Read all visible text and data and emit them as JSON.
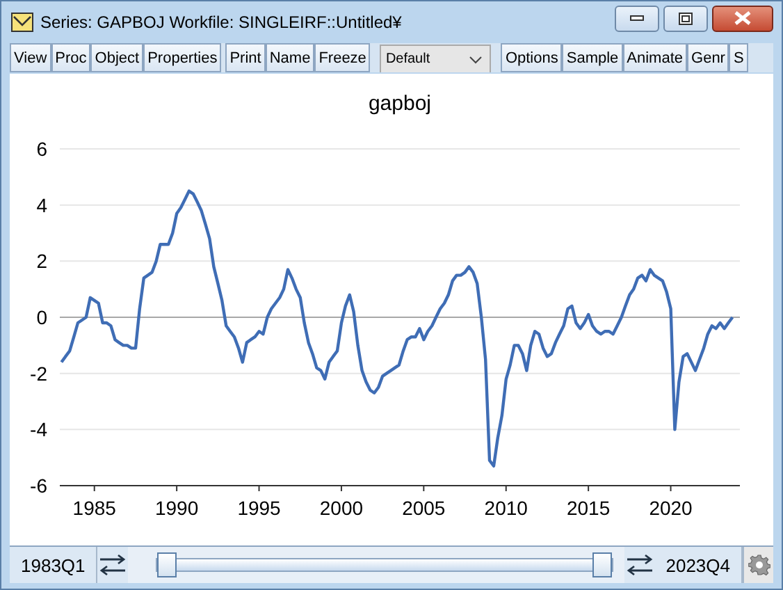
{
  "window": {
    "title": "Series: GAPBOJ   Workfile: SINGLEIRF::Untitled¥"
  },
  "toolbar": {
    "groups": [
      {
        "buttons": [
          "View",
          "Proc",
          "Object",
          "Properties"
        ]
      },
      {
        "buttons": [
          "Print",
          "Name",
          "Freeze"
        ]
      },
      {
        "dropdown": "Default"
      },
      {
        "buttons": [
          "Options",
          "Sample",
          "Animate",
          "Genr",
          "S"
        ]
      }
    ]
  },
  "graph": {
    "chart_data": {
      "type": "line",
      "title": "gapboj",
      "xlim": [
        1982.9,
        2024.2
      ],
      "ylim": [
        -6,
        6
      ],
      "xticks": [
        1985,
        1990,
        1995,
        2000,
        2005,
        2010,
        2015,
        2020
      ],
      "yticks": [
        -6,
        -4,
        -2,
        0,
        2,
        4,
        6
      ],
      "grid": true,
      "series": [
        {
          "color": "#3f6db5",
          "values": [
            -1.6,
            -1.4,
            -1.2,
            -0.7,
            -0.2,
            -0.1,
            0.0,
            0.7,
            0.6,
            0.5,
            -0.2,
            -0.2,
            -0.3,
            -0.8,
            -0.9,
            -1.0,
            -1.0,
            -1.1,
            -1.1,
            0.3,
            1.4,
            1.5,
            1.6,
            2.0,
            2.6,
            2.6,
            2.6,
            3.0,
            3.7,
            3.9,
            4.2,
            4.5,
            4.4,
            4.1,
            3.8,
            3.3,
            2.8,
            1.8,
            1.2,
            0.6,
            -0.3,
            -0.5,
            -0.7,
            -1.1,
            -1.6,
            -0.9,
            -0.8,
            -0.7,
            -0.5,
            -0.6,
            0.0,
            0.3,
            0.5,
            0.7,
            1.0,
            1.7,
            1.4,
            1.0,
            0.7,
            -0.2,
            -0.9,
            -1.3,
            -1.8,
            -1.9,
            -2.2,
            -1.6,
            -1.4,
            -1.2,
            -0.2,
            0.4,
            0.8,
            0.2,
            -1.0,
            -1.9,
            -2.3,
            -2.6,
            -2.7,
            -2.5,
            -2.1,
            -2.0,
            -1.9,
            -1.8,
            -1.7,
            -1.2,
            -0.8,
            -0.7,
            -0.7,
            -0.4,
            -0.8,
            -0.5,
            -0.3,
            0.0,
            0.3,
            0.5,
            0.8,
            1.3,
            1.5,
            1.5,
            1.6,
            1.8,
            1.6,
            1.2,
            0.0,
            -1.5,
            -5.1,
            -5.3,
            -4.3,
            -3.5,
            -2.2,
            -1.7,
            -1.0,
            -1.0,
            -1.3,
            -1.9,
            -1.0,
            -0.5,
            -0.6,
            -1.1,
            -1.4,
            -1.3,
            -0.9,
            -0.6,
            -0.3,
            0.3,
            0.4,
            -0.2,
            -0.4,
            -0.2,
            0.1,
            -0.3,
            -0.5,
            -0.6,
            -0.5,
            -0.5,
            -0.6,
            -0.3,
            0.0,
            0.4,
            0.8,
            1.0,
            1.4,
            1.5,
            1.3,
            1.7,
            1.5,
            1.4,
            1.3,
            0.9,
            0.3,
            -4.0,
            -2.3,
            -1.4,
            -1.3,
            -1.6,
            -1.9,
            -1.5,
            -1.1,
            -0.6,
            -0.3,
            -0.4,
            -0.2,
            -0.4,
            -0.2,
            0.0
          ]
        }
      ],
      "x": [
        1983,
        1983.25,
        1983.5,
        1983.75,
        1984,
        1984.25,
        1984.5,
        1984.75,
        1985,
        1985.25,
        1985.5,
        1985.75,
        1986,
        1986.25,
        1986.5,
        1986.75,
        1987,
        1987.25,
        1987.5,
        1987.75,
        1988,
        1988.25,
        1988.5,
        1988.75,
        1989,
        1989.25,
        1989.5,
        1989.75,
        1990,
        1990.25,
        1990.5,
        1990.75,
        1991,
        1991.25,
        1991.5,
        1991.75,
        1992,
        1992.25,
        1992.5,
        1992.75,
        1993,
        1993.25,
        1993.5,
        1993.75,
        1994,
        1994.25,
        1994.5,
        1994.75,
        1995,
        1995.25,
        1995.5,
        1995.75,
        1996,
        1996.25,
        1996.5,
        1996.75,
        1997,
        1997.25,
        1997.5,
        1997.75,
        1998,
        1998.25,
        1998.5,
        1998.75,
        1999,
        1999.25,
        1999.5,
        1999.75,
        2000,
        2000.25,
        2000.5,
        2000.75,
        2001,
        2001.25,
        2001.5,
        2001.75,
        2002,
        2002.25,
        2002.5,
        2002.75,
        2003,
        2003.25,
        2003.5,
        2003.75,
        2004,
        2004.25,
        2004.5,
        2004.75,
        2005,
        2005.25,
        2005.5,
        2005.75,
        2006,
        2006.25,
        2006.5,
        2006.75,
        2007,
        2007.25,
        2007.5,
        2007.75,
        2008,
        2008.25,
        2008.5,
        2008.75,
        2009,
        2009.25,
        2009.5,
        2009.75,
        2010,
        2010.25,
        2010.5,
        2010.75,
        2011,
        2011.25,
        2011.5,
        2011.75,
        2012,
        2012.25,
        2012.5,
        2012.75,
        2013,
        2013.25,
        2013.5,
        2013.75,
        2014,
        2014.25,
        2014.5,
        2014.75,
        2015,
        2015.25,
        2015.5,
        2015.75,
        2016,
        2016.25,
        2016.5,
        2016.75,
        2017,
        2017.25,
        2017.5,
        2017.75,
        2018,
        2018.25,
        2018.5,
        2018.75,
        2019,
        2019.25,
        2019.5,
        2019.75,
        2020,
        2020.25,
        2020.5,
        2020.75,
        2021,
        2021.25,
        2021.5,
        2021.75,
        2022,
        2022.25,
        2022.5,
        2022.75,
        2023,
        2023.25,
        2023.5,
        2023.75
      ]
    }
  },
  "sample_bar": {
    "start": "1983Q1",
    "end": "2023Q4",
    "handles": [
      {
        "level": 0
      },
      {
        "level": 1
      }
    ]
  }
}
